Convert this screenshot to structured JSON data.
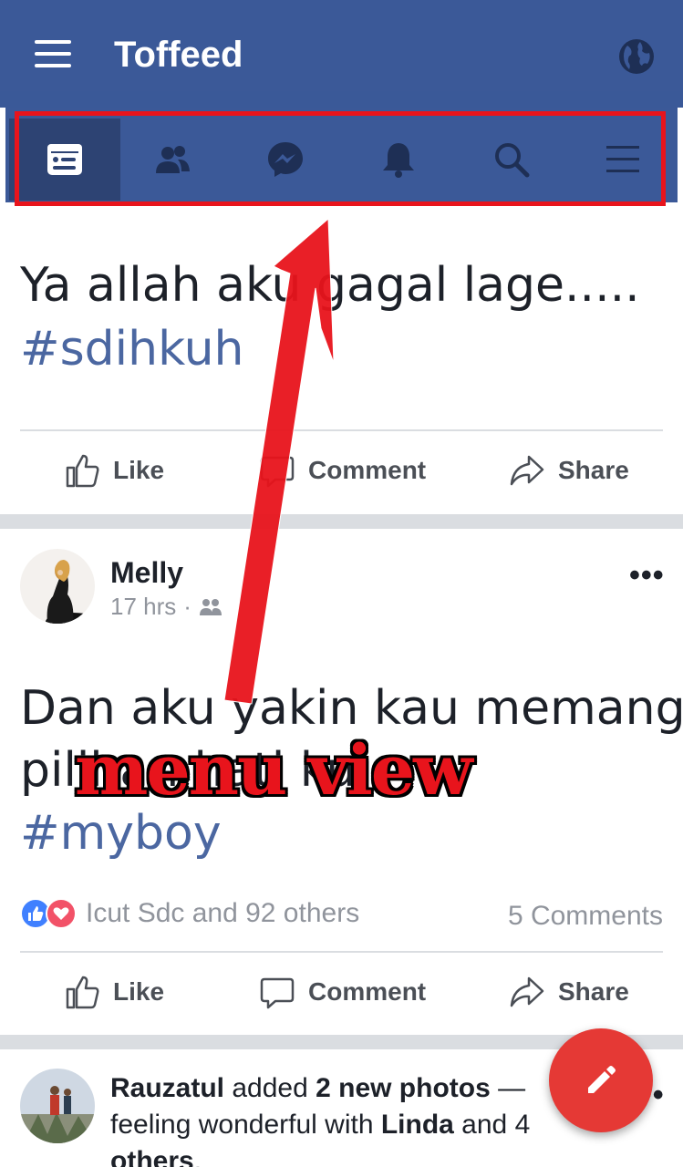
{
  "app": {
    "title": "Toffeed"
  },
  "tabs": [
    {
      "id": "news-feed",
      "icon": "news-feed-icon",
      "active": true
    },
    {
      "id": "friends",
      "icon": "friends-icon",
      "active": false
    },
    {
      "id": "messages",
      "icon": "messenger-icon",
      "active": false
    },
    {
      "id": "notifications",
      "icon": "bell-icon",
      "active": false
    },
    {
      "id": "search",
      "icon": "search-icon",
      "active": false
    },
    {
      "id": "menu",
      "icon": "menu-icon",
      "active": false
    }
  ],
  "post1": {
    "text": "Ya allah aku gagal lage.....",
    "hashtag": "#sdihkuh"
  },
  "actions": {
    "like": "Like",
    "comment": "Comment",
    "share": "Share"
  },
  "post2": {
    "author": "Melly",
    "time": "17 hrs",
    "separator": "·",
    "more": "•••",
    "text_line1": "Dan aku yakin kau memang",
    "text_line2": "pilihan hati ku",
    "hashtag": "#myboy",
    "reactions_text": "Icut Sdc and 92 others",
    "comments_count": "5 Comments"
  },
  "post3": {
    "author": "Rauzatul",
    "added": " added ",
    "photos": "2 new photos",
    "dash": " — ",
    "feeling": "feeling wonderful with ",
    "tagged": "Linda",
    "and": " and 4",
    "others": "others",
    "period": "."
  },
  "annotation": {
    "label": "menu view"
  },
  "colors": {
    "brand": "#3b5998",
    "highlight": "#e8141c",
    "fab": "#e53935",
    "hashtag": "#4b67a1"
  }
}
